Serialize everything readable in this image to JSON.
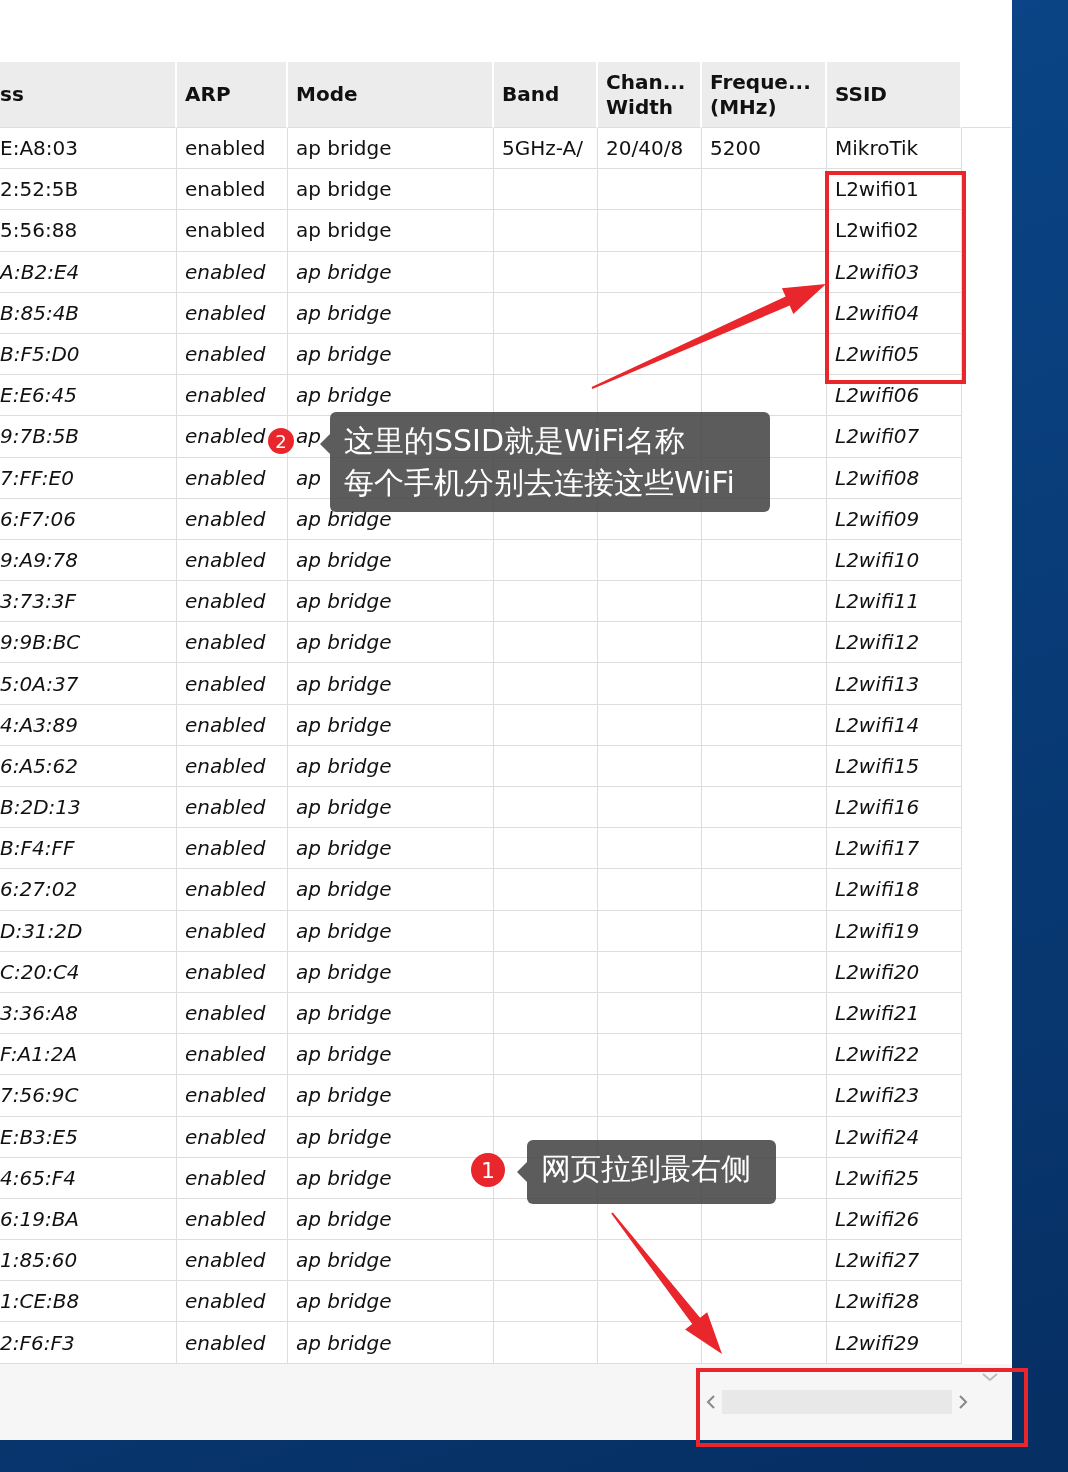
{
  "table": {
    "columns": [
      "ss",
      "ARP",
      "Mode",
      "Band",
      "Chan...\nWidth",
      "Freque...\n(MHz)",
      "SSID"
    ],
    "rows": [
      {
        "address": "E:A8:03",
        "arp": "enabled",
        "mode": "ap bridge",
        "band": "5GHz-A/",
        "channel_width": "20/40/8",
        "frequency": "5200",
        "ssid": "MikroTik",
        "dynamic": false
      },
      {
        "address": "2:52:5B",
        "arp": "enabled",
        "mode": "ap bridge",
        "ssid": "L2wifi01",
        "dynamic": false
      },
      {
        "address": "5:56:88",
        "arp": "enabled",
        "mode": "ap bridge",
        "ssid": "L2wifi02",
        "dynamic": false
      },
      {
        "address": "A:B2:E4",
        "arp": "enabled",
        "mode": "ap bridge",
        "ssid": "L2wifi03",
        "dynamic": true
      },
      {
        "address": "B:85:4B",
        "arp": "enabled",
        "mode": "ap bridge",
        "ssid": "L2wifi04",
        "dynamic": true
      },
      {
        "address": "B:F5:D0",
        "arp": "enabled",
        "mode": "ap bridge",
        "ssid": "L2wifi05",
        "dynamic": true
      },
      {
        "address": "E:E6:45",
        "arp": "enabled",
        "mode": "ap bridge",
        "ssid": "L2wifi06",
        "dynamic": true
      },
      {
        "address": "9:7B:5B",
        "arp": "enabled",
        "mode": "ap",
        "ssid": "L2wifi07",
        "dynamic": true
      },
      {
        "address": "7:FF:E0",
        "arp": "enabled",
        "mode": "ap",
        "ssid": "L2wifi08",
        "dynamic": true
      },
      {
        "address": "6:F7:06",
        "arp": "enabled",
        "mode": "ap bridge",
        "ssid": "L2wifi09",
        "dynamic": true
      },
      {
        "address": "9:A9:78",
        "arp": "enabled",
        "mode": "ap bridge",
        "ssid": "L2wifi10",
        "dynamic": true
      },
      {
        "address": "3:73:3F",
        "arp": "enabled",
        "mode": "ap bridge",
        "ssid": "L2wifi11",
        "dynamic": true
      },
      {
        "address": "9:9B:BC",
        "arp": "enabled",
        "mode": "ap bridge",
        "ssid": "L2wifi12",
        "dynamic": true
      },
      {
        "address": "5:0A:37",
        "arp": "enabled",
        "mode": "ap bridge",
        "ssid": "L2wifi13",
        "dynamic": true
      },
      {
        "address": "4:A3:89",
        "arp": "enabled",
        "mode": "ap bridge",
        "ssid": "L2wifi14",
        "dynamic": true
      },
      {
        "address": "6:A5:62",
        "arp": "enabled",
        "mode": "ap bridge",
        "ssid": "L2wifi15",
        "dynamic": true
      },
      {
        "address": "B:2D:13",
        "arp": "enabled",
        "mode": "ap bridge",
        "ssid": "L2wifi16",
        "dynamic": true
      },
      {
        "address": "B:F4:FF",
        "arp": "enabled",
        "mode": "ap bridge",
        "ssid": "L2wifi17",
        "dynamic": true
      },
      {
        "address": "6:27:02",
        "arp": "enabled",
        "mode": "ap bridge",
        "ssid": "L2wifi18",
        "dynamic": true
      },
      {
        "address": "D:31:2D",
        "arp": "enabled",
        "mode": "ap bridge",
        "ssid": "L2wifi19",
        "dynamic": true
      },
      {
        "address": "C:20:C4",
        "arp": "enabled",
        "mode": "ap bridge",
        "ssid": "L2wifi20",
        "dynamic": true
      },
      {
        "address": "3:36:A8",
        "arp": "enabled",
        "mode": "ap bridge",
        "ssid": "L2wifi21",
        "dynamic": true
      },
      {
        "address": "F:A1:2A",
        "arp": "enabled",
        "mode": "ap bridge",
        "ssid": "L2wifi22",
        "dynamic": true
      },
      {
        "address": "7:56:9C",
        "arp": "enabled",
        "mode": "ap bridge",
        "ssid": "L2wifi23",
        "dynamic": true
      },
      {
        "address": "E:B3:E5",
        "arp": "enabled",
        "mode": "ap bridge",
        "ssid": "L2wifi24",
        "dynamic": true
      },
      {
        "address": "4:65:F4",
        "arp": "enabled",
        "mode": "ap bridge",
        "ssid": "L2wifi25",
        "dynamic": true
      },
      {
        "address": "6:19:BA",
        "arp": "enabled",
        "mode": "ap bridge",
        "ssid": "L2wifi26",
        "dynamic": true
      },
      {
        "address": "1:85:60",
        "arp": "enabled",
        "mode": "ap bridge",
        "ssid": "L2wifi27",
        "dynamic": true
      },
      {
        "address": "1:CE:B8",
        "arp": "enabled",
        "mode": "ap bridge",
        "ssid": "L2wifi28",
        "dynamic": true
      },
      {
        "address": "2:F6:F3",
        "arp": "enabled",
        "mode": "ap bridge",
        "ssid": "L2wifi29",
        "dynamic": true
      }
    ]
  },
  "annotations": [
    {
      "number": "2",
      "lines": [
        "这里的SSID就是WiFi名称",
        "每个手机分别去连接这些WiFi"
      ]
    },
    {
      "number": "1",
      "lines": [
        "网页拉到最右侧"
      ]
    }
  ]
}
